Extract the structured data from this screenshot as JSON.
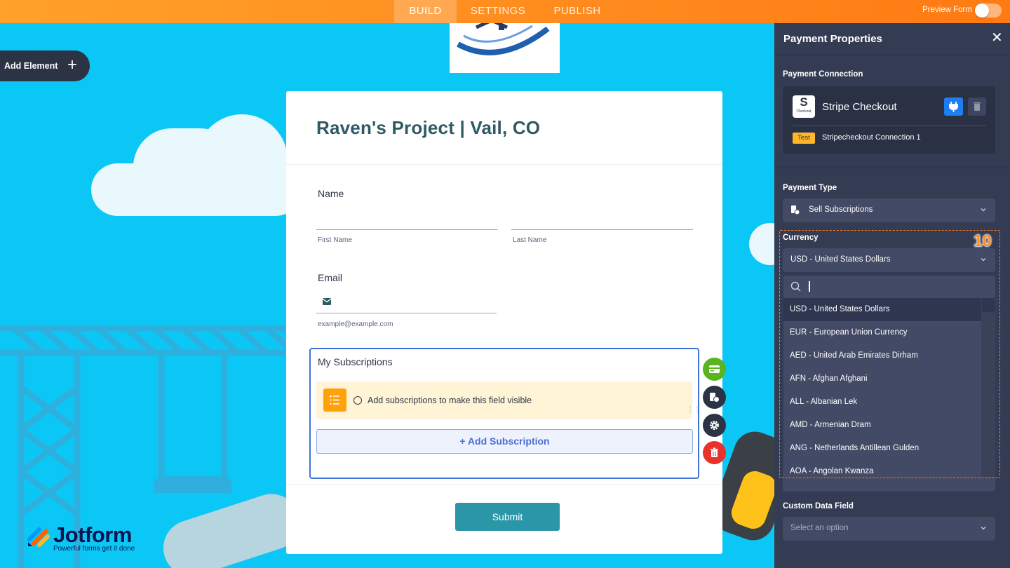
{
  "topbar": {
    "tabs": [
      {
        "label": "BUILD",
        "active": true
      },
      {
        "label": "SETTINGS",
        "active": false
      },
      {
        "label": "PUBLISH",
        "active": false
      }
    ],
    "preview_label": "Preview Form"
  },
  "add_element": {
    "label": "Add Element"
  },
  "form": {
    "title": "Raven's Project | Vail, CO",
    "name_label": "Name",
    "first_name_sub": "First Name",
    "last_name_sub": "Last Name",
    "email_label": "Email",
    "email_sub": "example@example.com",
    "subscriptions_label": "My Subscriptions",
    "notice_text": "Add subscriptions to make this field visible",
    "add_subscription": "+ Add Subscription",
    "submit": "Submit"
  },
  "branding": {
    "word": "Jotform",
    "tagline": "Powerful forms get it done"
  },
  "panel": {
    "title": "Payment Properties",
    "connection_label": "Payment Connection",
    "gateway_name": "Stripe Checkout",
    "gateway_icon_letter": "S",
    "gateway_icon_caption": "Checkout",
    "test_badge": "Test",
    "connection_name": "Stripecheckout Connection 1",
    "payment_type_label": "Payment Type",
    "payment_type_value": "Sell Subscriptions",
    "currency_label": "Currency",
    "currency_value": "USD - United States Dollars",
    "currency_options": [
      "USD - United States Dollars",
      "EUR - European Union Currency",
      "AED - United Arab Emirates Dirham",
      "AFN - Afghan Afghani",
      "ALL - Albanian Lek",
      "AMD - Armenian Dram",
      "ANG - Netherlands Antillean Gulden",
      "AOA - Angolan Kwanza"
    ],
    "custom_data_label": "Custom Data Field",
    "custom_data_placeholder": "Select an option"
  },
  "annotation": {
    "step_number": "10",
    "color": "#ff7a12"
  },
  "colors": {
    "accent_orange": "#ff8a1d",
    "panel_bg": "#343c54",
    "canvas_bg": "#0bc7f5",
    "title_teal": "#2e5a63",
    "submit_teal": "#2b96a8",
    "selection_blue": "#3f74d6"
  }
}
